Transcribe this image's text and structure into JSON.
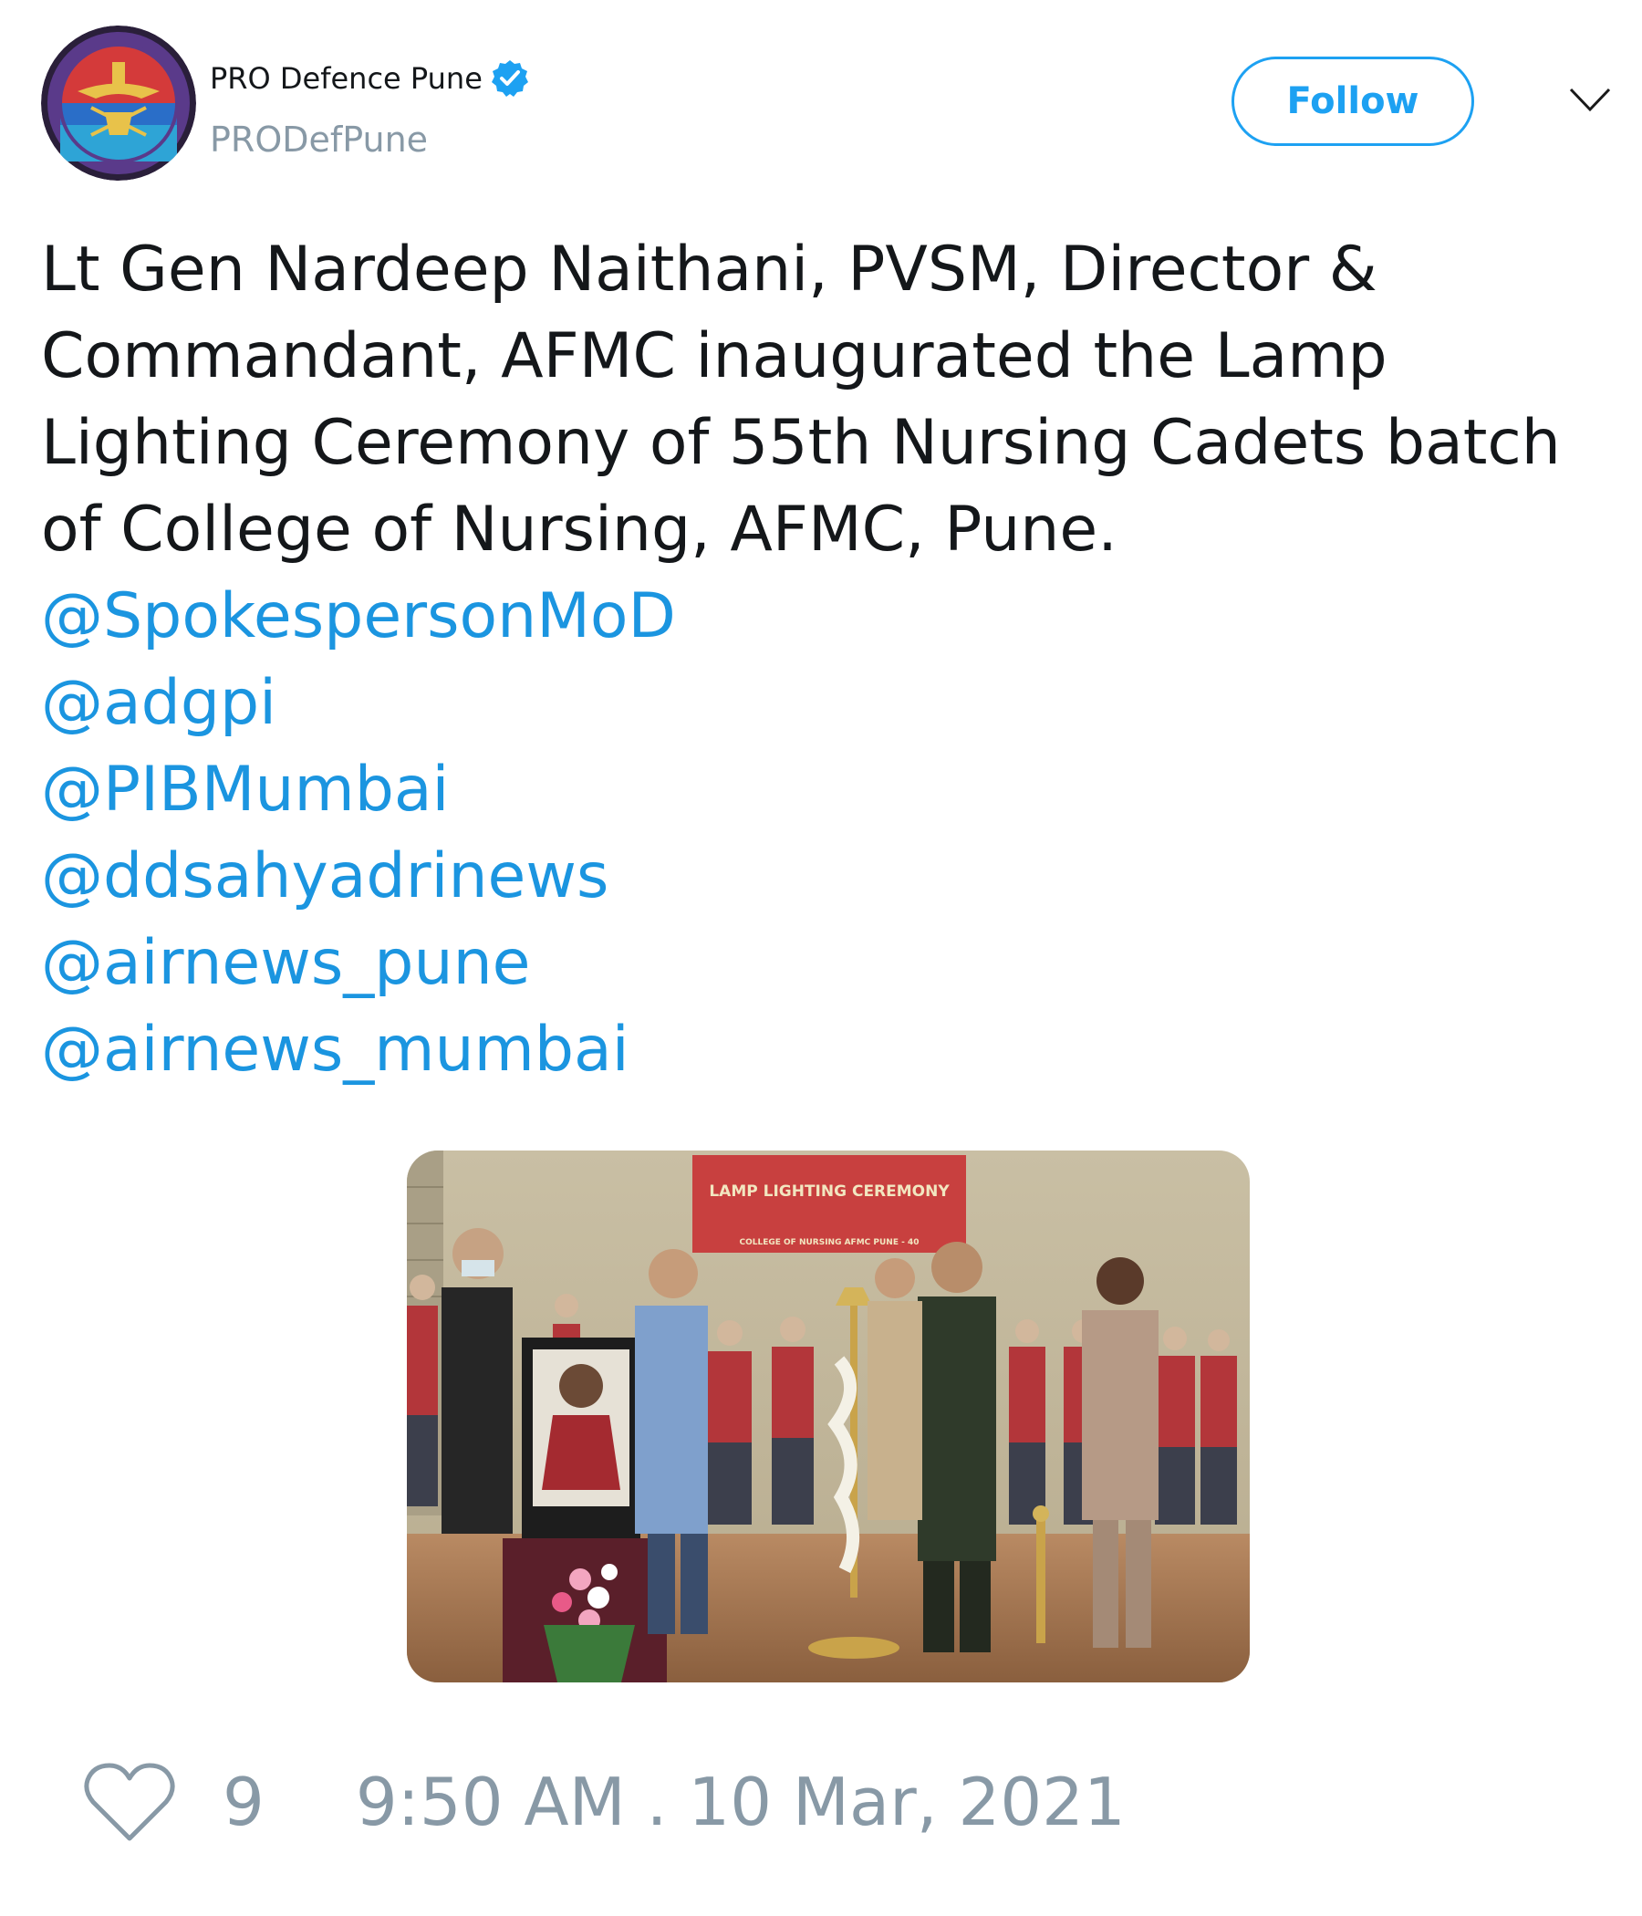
{
  "author": {
    "name": "PRO Defence Pune",
    "handle": "PRODefPune",
    "verified": true,
    "avatar_icon": "defence-emblem-avatar"
  },
  "actions": {
    "follow_label": "Follow",
    "menu_icon": "chevron-down-icon"
  },
  "tweet": {
    "lines": [
      "Lt Gen Nardeep Naithani, PVSM, Director &",
      "Commandant, AFMC inaugurated the Lamp",
      "Lighting Ceremony of 55th Nursing Cadets batch",
      "of College of Nursing, AFMC, Pune."
    ],
    "mentions": [
      "@SpokespersonMoD",
      "@adgpi",
      "@PIBMumbai",
      "@ddsahyadrinews",
      "@airnews_pune",
      "@airnews_mumbai"
    ]
  },
  "media": {
    "banner_title": "LAMP LIGHTING CEREMONY",
    "banner_subtitle": "COLLEGE OF NURSING AFMC PUNE - 40"
  },
  "footer": {
    "like_icon": "heart-icon",
    "like_count": "9",
    "timestamp": "9:50 AM . 10 Mar, 2021"
  },
  "colors": {
    "link": "#1b95e0",
    "follow": "#1da1f2",
    "muted": "#8899a6",
    "text": "#14171a"
  }
}
